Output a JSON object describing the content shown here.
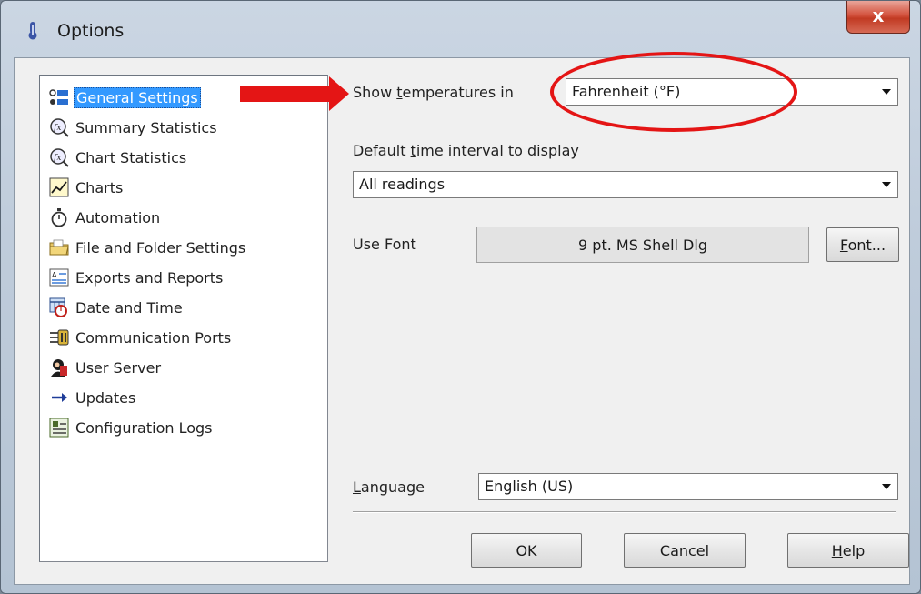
{
  "window": {
    "title": "Options",
    "close_label": "x"
  },
  "tree": {
    "items": [
      {
        "label": "General Settings",
        "icon": "general-settings-icon",
        "selected": true
      },
      {
        "label": "Summary Statistics",
        "icon": "fx-magnifier-icon"
      },
      {
        "label": "Chart Statistics",
        "icon": "fx-magnifier-icon"
      },
      {
        "label": "Charts",
        "icon": "line-chart-icon"
      },
      {
        "label": "Automation",
        "icon": "stopwatch-icon"
      },
      {
        "label": "File and Folder Settings",
        "icon": "folder-icon"
      },
      {
        "label": "Exports and Reports",
        "icon": "export-report-icon"
      },
      {
        "label": "Date and Time",
        "icon": "calendar-clock-icon"
      },
      {
        "label": "Communication Ports",
        "icon": "comm-ports-icon"
      },
      {
        "label": "User Server",
        "icon": "user-server-icon"
      },
      {
        "label": "Updates",
        "icon": "arrow-right-icon"
      },
      {
        "label": "Configuration Logs",
        "icon": "config-logs-icon"
      }
    ]
  },
  "settings": {
    "temp_label_pre": "Show ",
    "temp_label_u": "t",
    "temp_label_post": "emperatures in",
    "temp_value": "Fahrenheit (°F)",
    "interval_label_pre": "Default ",
    "interval_label_u": "t",
    "interval_label_post": "ime interval to display",
    "interval_value": "All readings",
    "font_label": "Use Font",
    "font_value": "9 pt. MS Shell Dlg",
    "font_button_u": "F",
    "font_button_post": "ont...",
    "language_label_u": "L",
    "language_label_post": "anguage",
    "language_value": "English (US)"
  },
  "buttons": {
    "ok": "OK",
    "cancel": "Cancel",
    "help_u": "H",
    "help_post": "elp"
  },
  "colors": {
    "selection": "#3399ff",
    "annotation": "#e41515",
    "close": "#c13a23"
  }
}
